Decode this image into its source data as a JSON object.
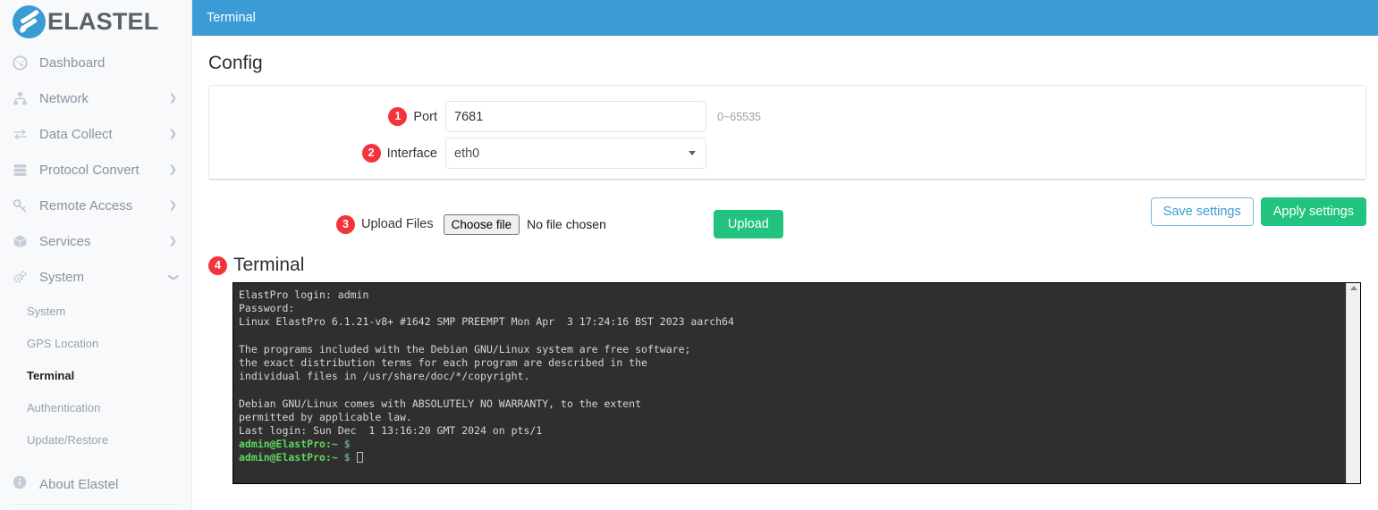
{
  "brand": {
    "name": "ELASTEL",
    "logo_color": "#3a9bd5"
  },
  "topbar": {
    "tab_label": "Terminal",
    "bg_color": "#3a9bd5"
  },
  "sidebar": {
    "items": [
      {
        "label": "Dashboard",
        "icon": "gauge-icon",
        "has_chevron": false,
        "expanded": false
      },
      {
        "label": "Network",
        "icon": "sitemap-icon",
        "has_chevron": true,
        "expanded": false
      },
      {
        "label": "Data Collect",
        "icon": "exchange-icon",
        "has_chevron": true,
        "expanded": false
      },
      {
        "label": "Protocol Convert",
        "icon": "server-icon",
        "has_chevron": true,
        "expanded": false
      },
      {
        "label": "Remote Access",
        "icon": "key-icon",
        "has_chevron": true,
        "expanded": false
      },
      {
        "label": "Services",
        "icon": "cube-icon",
        "has_chevron": true,
        "expanded": false
      },
      {
        "label": "System",
        "icon": "gears-icon",
        "has_chevron": true,
        "expanded": true
      }
    ],
    "system_subitems": [
      {
        "label": "System",
        "active": false
      },
      {
        "label": "GPS Location",
        "active": false
      },
      {
        "label": "Terminal",
        "active": true
      },
      {
        "label": "Authentication",
        "active": false
      },
      {
        "label": "Update/Restore",
        "active": false
      }
    ],
    "about": {
      "label": "About Elastel",
      "icon": "info-icon"
    }
  },
  "config": {
    "heading": "Config",
    "port": {
      "badge": "1",
      "label": "Port",
      "value": "7681",
      "placeholder": "",
      "hint": "0~65535"
    },
    "interface": {
      "badge": "2",
      "label": "Interface",
      "value": "eth0",
      "options": [
        "eth0"
      ],
      "caret_icon": "chevron-down-icon"
    }
  },
  "actions": {
    "save_label": "Save settings",
    "apply_label": "Apply settings",
    "save_color": "#3a9bd5",
    "apply_color": "#22c37e"
  },
  "upload": {
    "badge": "3",
    "label": "Upload Files",
    "choose_label": "Choose file",
    "file_status": "No file chosen",
    "upload_label": "Upload",
    "upload_color": "#22c37e"
  },
  "terminal": {
    "badge": "4",
    "heading": "Terminal",
    "background": "#2f2f2f",
    "lines": [
      {
        "type": "plain",
        "text": "ElastPro login: admin"
      },
      {
        "type": "plain",
        "text": "Password:"
      },
      {
        "type": "plain",
        "text": "Linux ElastPro 6.1.21-v8+ #1642 SMP PREEMPT Mon Apr  3 17:24:16 BST 2023 aarch64"
      },
      {
        "type": "plain",
        "text": ""
      },
      {
        "type": "plain",
        "text": "The programs included with the Debian GNU/Linux system are free software;"
      },
      {
        "type": "plain",
        "text": "the exact distribution terms for each program are described in the"
      },
      {
        "type": "plain",
        "text": "individual files in /usr/share/doc/*/copyright."
      },
      {
        "type": "plain",
        "text": ""
      },
      {
        "type": "plain",
        "text": "Debian GNU/Linux comes with ABSOLUTELY NO WARRANTY, to the extent"
      },
      {
        "type": "plain",
        "text": "permitted by applicable law."
      },
      {
        "type": "plain",
        "text": "Last login: Sun Dec  1 13:16:20 GMT 2024 on pts/1"
      },
      {
        "type": "prompt",
        "user": "admin@ElastPro",
        "path": ":~",
        "sigil": "$",
        "text": "",
        "cursor": false
      },
      {
        "type": "prompt",
        "user": "admin@ElastPro",
        "path": ":~",
        "sigil": "$",
        "text": "",
        "cursor": true
      }
    ],
    "scrollbar": {
      "icon": "scroll-up-arrow-icon"
    }
  }
}
